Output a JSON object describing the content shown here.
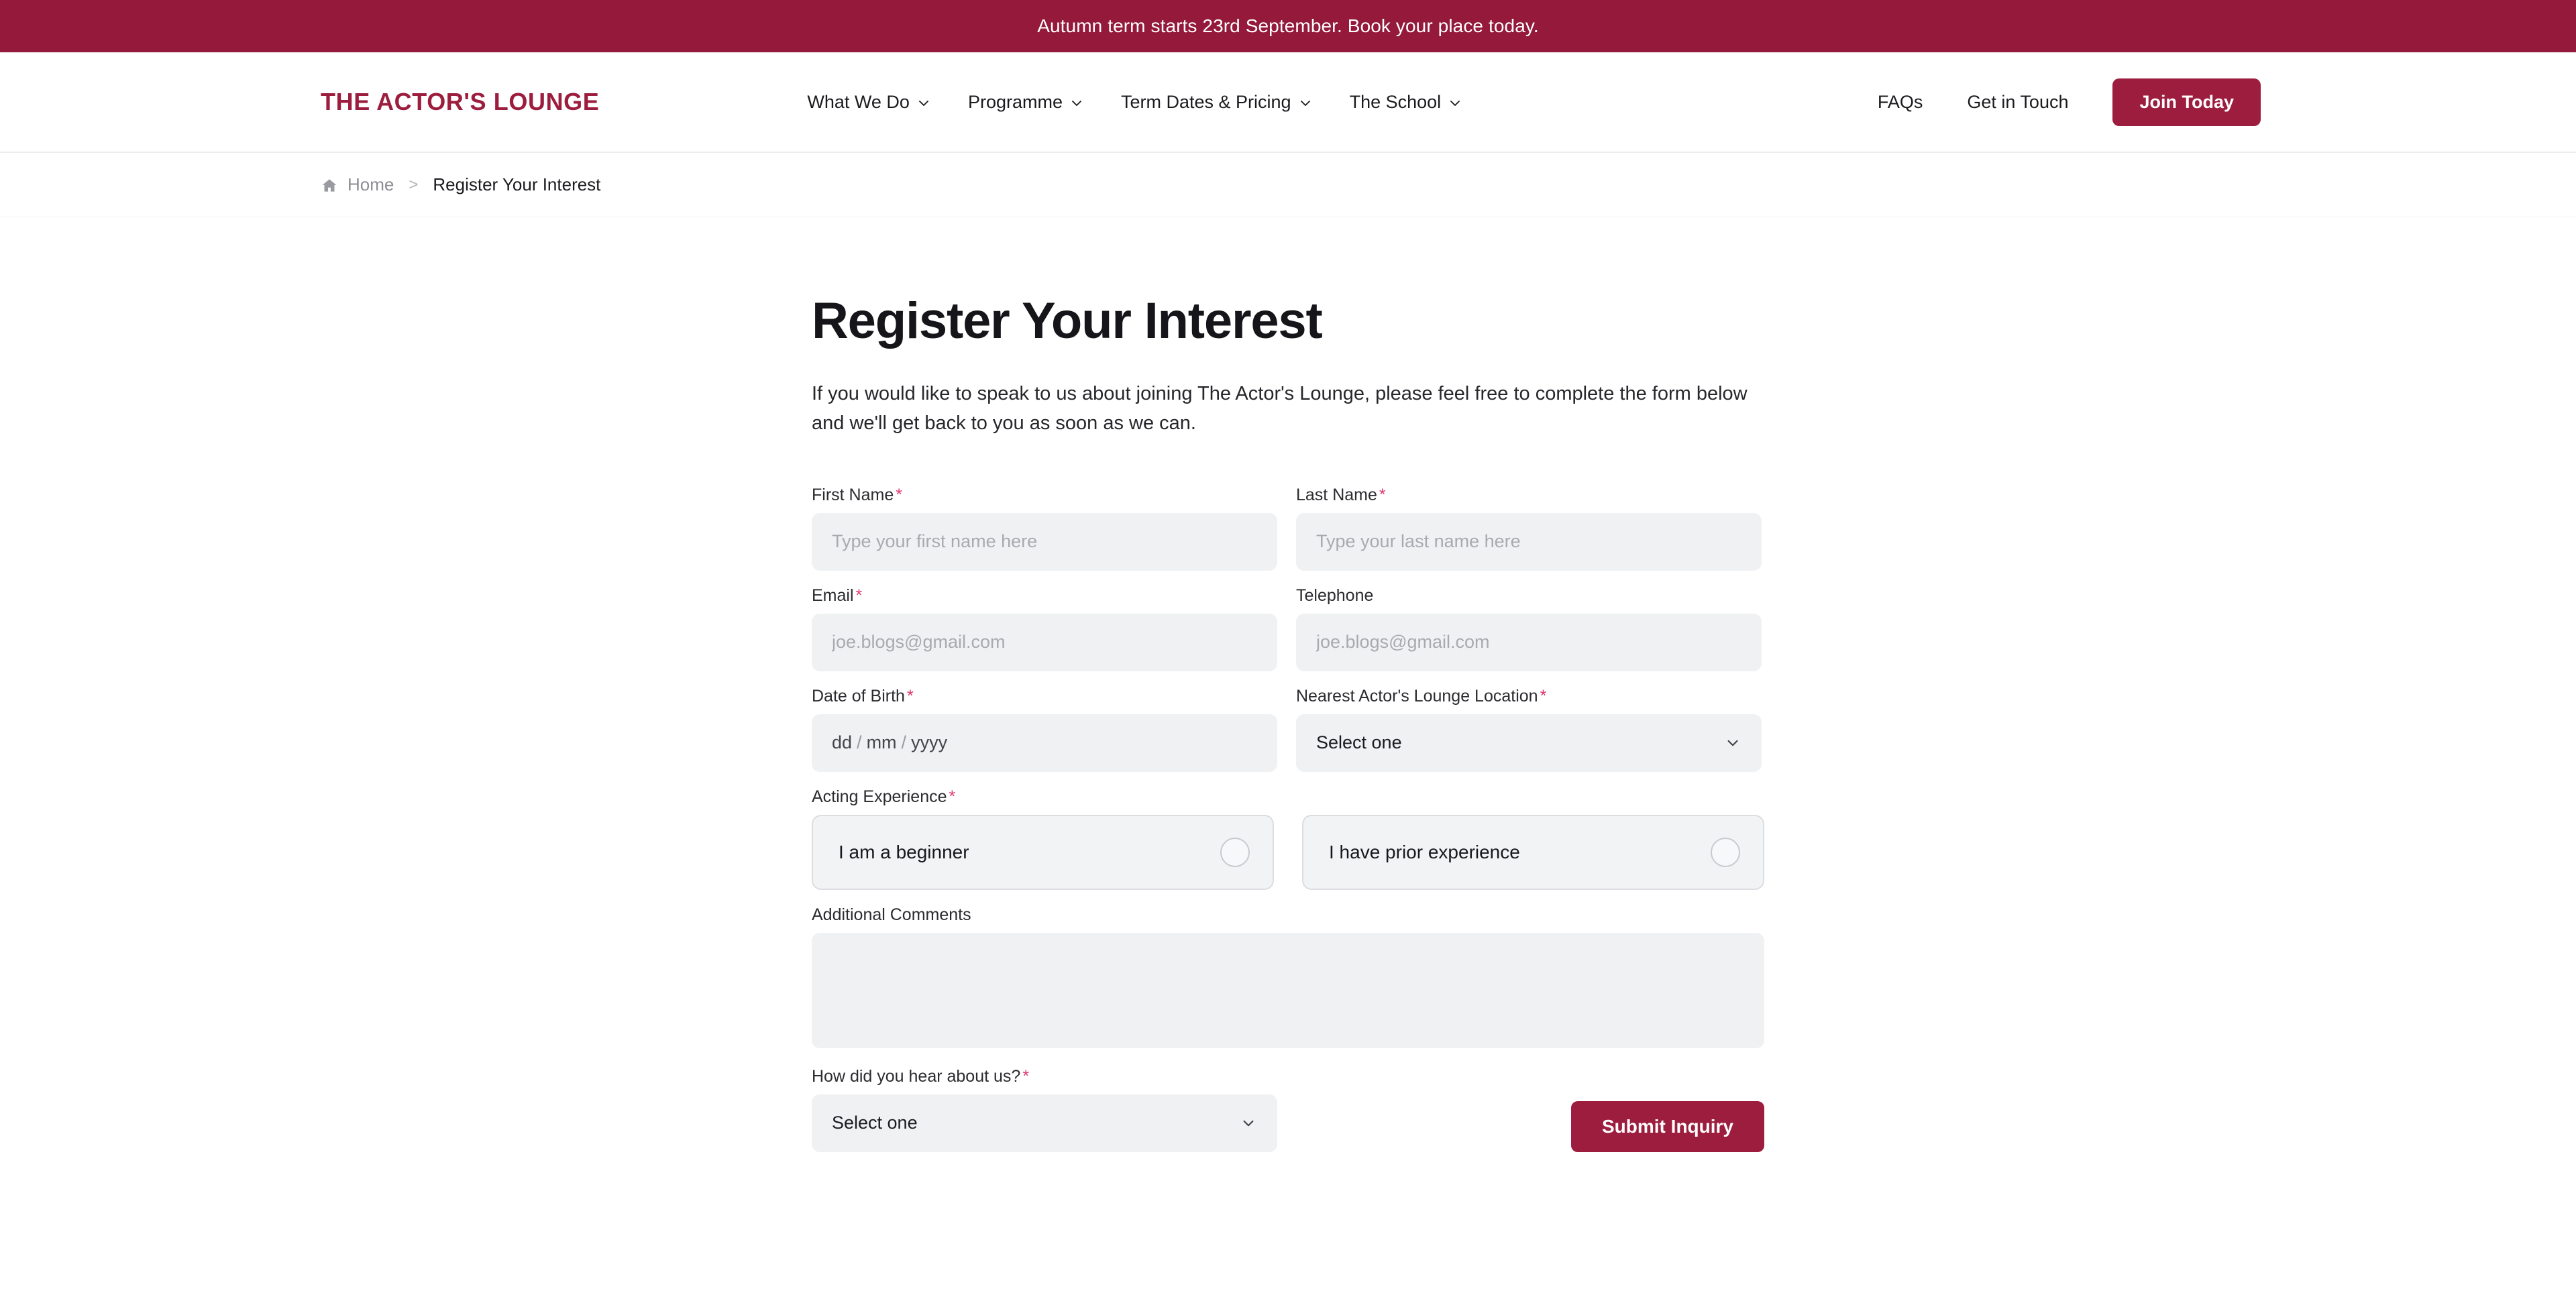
{
  "announcement": {
    "text": "Autumn term starts 23rd September. Book your place today.",
    "background": "#94193A"
  },
  "header": {
    "logo": "THE ACTOR'S LOUNGE",
    "logo_color": "#9C1D3D",
    "nav": [
      {
        "label": "What We Do",
        "has_dropdown": true,
        "icon": "chevron-down-icon"
      },
      {
        "label": "Programme",
        "has_dropdown": true,
        "icon": "chevron-down-icon"
      },
      {
        "label": "Term Dates & Pricing",
        "has_dropdown": true,
        "icon": "chevron-down-icon"
      },
      {
        "label": "The School",
        "has_dropdown": true,
        "icon": "chevron-down-icon"
      }
    ],
    "links": [
      {
        "label": "FAQs"
      },
      {
        "label": "Get in Touch"
      }
    ],
    "cta": {
      "label": "Join Today",
      "color": "#9C1D3D"
    }
  },
  "breadcrumb": {
    "home_icon": "home-icon",
    "home_label": "Home",
    "separator": ">",
    "current": "Register Your Interest"
  },
  "main": {
    "title": "Register Your Interest",
    "intro": "If you would like to speak to us about joining The Actor's Lounge, please feel free to complete the form below and we'll get back to you as soon as we can.",
    "form": {
      "first_name": {
        "label": "First Name",
        "required_mark": "*",
        "placeholder": "Type your first name here",
        "value": ""
      },
      "last_name": {
        "label": "Last Name",
        "required_mark": "*",
        "placeholder": "Type your last name here",
        "value": ""
      },
      "email": {
        "label": "Email",
        "required_mark": "*",
        "placeholder": "joe.blogs@gmail.com",
        "value": ""
      },
      "telephone": {
        "label": "Telephone",
        "required_mark": "",
        "placeholder": "joe.blogs@gmail.com",
        "value": ""
      },
      "date_of_birth": {
        "label": "Date of Birth",
        "required_mark": "*",
        "day": "dd",
        "month": "mm",
        "year": "yyyy",
        "separator": "/"
      },
      "location": {
        "label": "Nearest Actor's Lounge Location",
        "required_mark": "*",
        "selected": "Select one",
        "icon": "chevron-down-icon"
      },
      "acting_experience": {
        "label": "Acting Experience",
        "required_mark": "*",
        "options": [
          {
            "label": "I am a beginner",
            "selected": false
          },
          {
            "label": "I have prior experience",
            "selected": false
          }
        ]
      },
      "additional_comments": {
        "label": "Additional Comments",
        "required_mark": "",
        "placeholder": "",
        "value": ""
      },
      "hear_about_us": {
        "label": "How did you hear about us?",
        "required_mark": "*",
        "selected": "Select one",
        "icon": "chevron-down-icon"
      },
      "submit": {
        "label": "Submit Inquiry",
        "color": "#9C1D3D"
      },
      "required_color": "#e0366d",
      "input_background": "#F0F1F3"
    }
  }
}
